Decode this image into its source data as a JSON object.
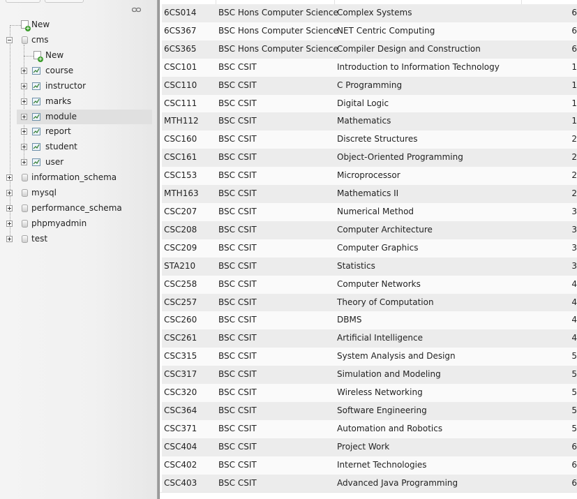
{
  "navigation": {
    "tree": [
      {
        "label": "New",
        "type": "new",
        "level": 1
      },
      {
        "label": "cms",
        "type": "database",
        "level": 0,
        "expanded": true
      },
      {
        "label": "New",
        "type": "new",
        "level": 2
      },
      {
        "label": "course",
        "type": "table",
        "level": 1
      },
      {
        "label": "instructor",
        "type": "table",
        "level": 1
      },
      {
        "label": "marks",
        "type": "table",
        "level": 1
      },
      {
        "label": "module",
        "type": "table",
        "level": 1,
        "selected": true
      },
      {
        "label": "report",
        "type": "table",
        "level": 1
      },
      {
        "label": "student",
        "type": "table",
        "level": 1
      },
      {
        "label": "user",
        "type": "table",
        "level": 1
      },
      {
        "label": "information_schema",
        "type": "database",
        "level": 0
      },
      {
        "label": "mysql",
        "type": "database",
        "level": 0
      },
      {
        "label": "performance_schema",
        "type": "database",
        "level": 0
      },
      {
        "label": "phpmyadmin",
        "type": "database",
        "level": 0
      },
      {
        "label": "test",
        "type": "database",
        "level": 0
      }
    ]
  },
  "table": {
    "rows": [
      [
        "6CS014",
        "BSC Hons Computer Science",
        "Complex Systems",
        "6"
      ],
      [
        "6CS367",
        "BSC Hons Computer Science",
        "NET Centric Computing",
        "6"
      ],
      [
        "6CS365",
        "BSC Hons Computer Science",
        "Compiler Design and Construction",
        "6"
      ],
      [
        "CSC101",
        "BSC CSIT",
        "Introduction to Information Technology",
        "1"
      ],
      [
        "CSC110",
        "BSC CSIT",
        "C Programming",
        "1"
      ],
      [
        "CSC111",
        "BSC CSIT",
        "Digital Logic",
        "1"
      ],
      [
        "MTH112",
        "BSC CSIT",
        "Mathematics",
        "1"
      ],
      [
        "CSC160",
        "BSC CSIT",
        "Discrete Structures",
        "2"
      ],
      [
        "CSC161",
        "BSC CSIT",
        "Object-Oriented Programming",
        "2"
      ],
      [
        "CSC153",
        "BSC CSIT",
        "Microprocessor",
        "2"
      ],
      [
        "MTH163",
        "BSC CSIT",
        "Mathematics II",
        "2"
      ],
      [
        "CSC207",
        "BSC CSIT",
        "Numerical Method",
        "3"
      ],
      [
        "CSC208",
        "BSC CSIT",
        "Computer Architecture",
        "3"
      ],
      [
        "CSC209",
        "BSC CSIT",
        "Computer Graphics",
        "3"
      ],
      [
        "STA210",
        "BSC CSIT",
        "Statistics",
        "3"
      ],
      [
        "CSC258",
        "BSC CSIT",
        "Computer Networks",
        "4"
      ],
      [
        "CSC257",
        "BSC CSIT",
        "Theory of Computation",
        "4"
      ],
      [
        "CSC260",
        "BSC CSIT",
        "DBMS",
        "4"
      ],
      [
        "CSC261",
        "BSC CSIT",
        "Artificial Intelligence",
        "4"
      ],
      [
        "CSC315",
        "BSC CSIT",
        "System Analysis and Design",
        "5"
      ],
      [
        "CSC317",
        "BSC CSIT",
        "Simulation and Modeling",
        "5"
      ],
      [
        "CSC320",
        "BSC CSIT",
        "Wireless Networking",
        "5"
      ],
      [
        "CSC364",
        "BSC CSIT",
        "Software Engineering",
        "5"
      ],
      [
        "CSC371",
        "BSC CSIT",
        "Automation and Robotics",
        "5"
      ],
      [
        "CSC404",
        "BSC CSIT",
        "Project Work",
        "6"
      ],
      [
        "CSC402",
        "BSC CSIT",
        "Internet Technologies",
        "6"
      ],
      [
        "CSC403",
        "BSC CSIT",
        "Advanced Java Programming",
        "6"
      ]
    ]
  },
  "colors": {
    "row_odd": "#ececec",
    "row_even": "#fafafa",
    "panel_bg": "#f1f1f1",
    "selected_bg": "#e0e0e0"
  }
}
